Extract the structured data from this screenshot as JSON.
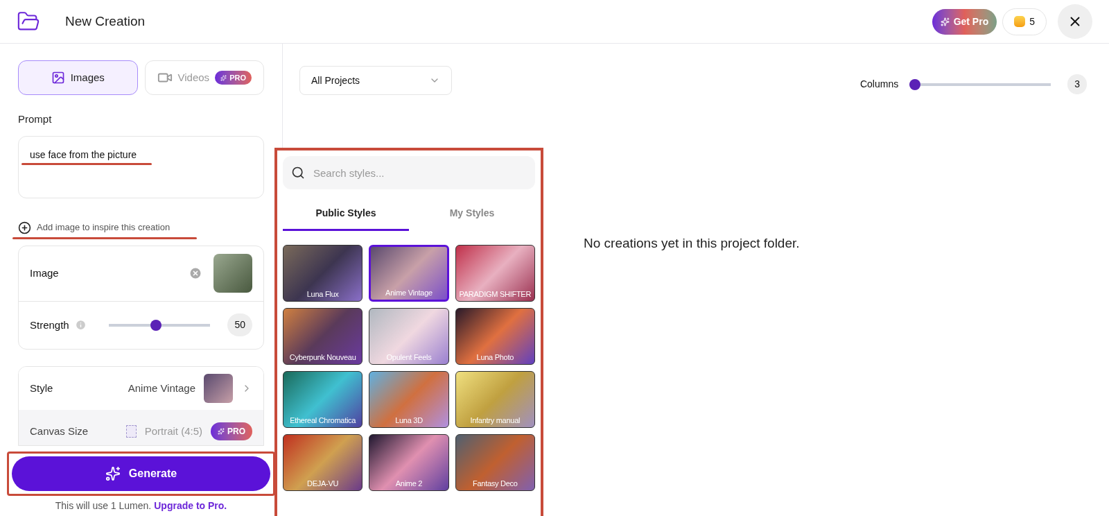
{
  "header": {
    "title": "New Creation",
    "get_pro": "Get Pro",
    "credits": "5"
  },
  "mode_tabs": [
    {
      "label": "Images",
      "selected": true
    },
    {
      "label": "Videos",
      "selected": false,
      "pro_badge": "PRO"
    }
  ],
  "prompt": {
    "label": "Prompt",
    "value": "use face from the picture",
    "underlined": true
  },
  "add_image": {
    "label": "Add image to inspire this creation",
    "underlined": true
  },
  "image_card": {
    "label": "Image",
    "strength_label": "Strength",
    "level": 0.46,
    "strength_value": "50"
  },
  "settings": [
    {
      "kind": "style",
      "label": "Style",
      "value": "Anime Vintage"
    },
    {
      "kind": "canvas",
      "label": "Canvas Size",
      "value": "Portrait (4:5)",
      "badge": "PRO"
    }
  ],
  "generate": {
    "label": "Generate",
    "highlighted": true,
    "note": "This will use 1 Lumen.",
    "link": "Upgrade to Pro."
  },
  "filter": {
    "value": "All Projects"
  },
  "columns": {
    "label": "Columns",
    "level": 0,
    "value": "3"
  },
  "empty_message": "No creations yet in this project folder.",
  "style_picker": {
    "highlighted": true,
    "search_placeholder": "Search styles...",
    "tabs": [
      {
        "label": "Public Styles",
        "selected": true
      },
      {
        "label": "My Styles",
        "selected": false
      }
    ],
    "styles": [
      {
        "name": "Luna Flux",
        "selected": false
      },
      {
        "name": "Anime Vintage",
        "selected": true
      },
      {
        "name": "PARADIGM SHIFTER",
        "selected": false
      },
      {
        "name": "Cyberpunk Nouveau",
        "selected": false
      },
      {
        "name": "Opulent Feels",
        "selected": false
      },
      {
        "name": "Luna Photo",
        "selected": false
      },
      {
        "name": "Ethereal Chromatica",
        "selected": false
      },
      {
        "name": "Luna 3D",
        "selected": false
      },
      {
        "name": "Infantry manual",
        "selected": false
      },
      {
        "name": "DEJA-VU",
        "selected": false
      },
      {
        "name": "Anime 2",
        "selected": false
      },
      {
        "name": "Fantasy Deco",
        "selected": false
      }
    ]
  }
}
